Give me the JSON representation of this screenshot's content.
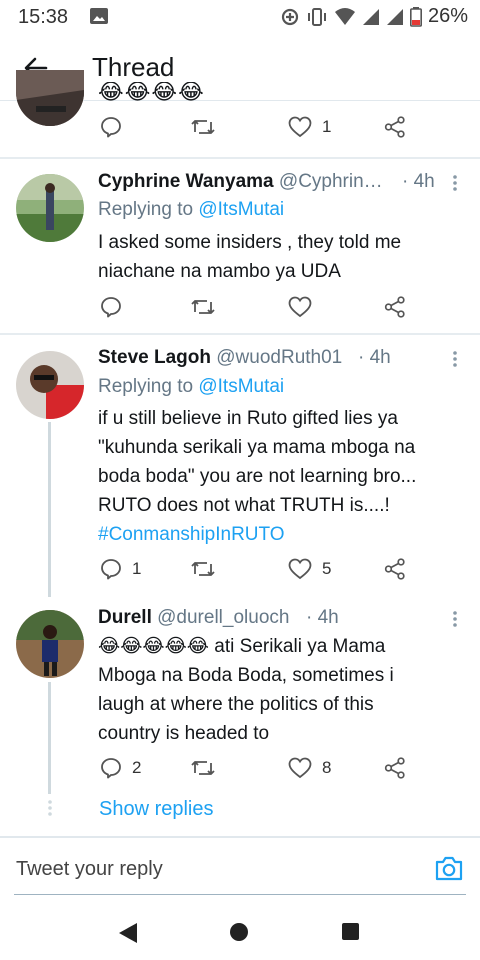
{
  "status_bar": {
    "time": "15:38",
    "battery_percent": "26%"
  },
  "header": {
    "title": "Thread"
  },
  "previous_tweet": {
    "emojis": "😂😂😂😂",
    "like_count": "1"
  },
  "tweets": [
    {
      "name": "Cyphrine Wanyama",
      "handle": "@Cyphrin…",
      "time": "· 4h",
      "replying_prefix": "Replying to ",
      "replying_to": "@ItsMutai",
      "text_lines": [
        "I asked some insiders , they told me",
        "niachane na mambo ya UDA"
      ],
      "reply_count": "",
      "like_count": ""
    },
    {
      "name": "Steve Lagoh",
      "handle": "@wuodRuth01",
      "time": "· 4h",
      "replying_prefix": "Replying to ",
      "replying_to": "@ItsMutai",
      "text_lines": [
        "if u still believe in Ruto gifted lies ya",
        "\"kuhunda serikali ya mama mboga na",
        "boda boda\" you are not learning bro...",
        "RUTO does not what TRUTH is....!"
      ],
      "hashtag": "#ConmanshipInRUTO",
      "reply_count": "1",
      "like_count": "5"
    },
    {
      "name": "Durell",
      "handle": "@durell_oluoch",
      "time": "· 4h",
      "emojis": "😂😂😂😂😂",
      "text_lines": [
        " ati Serikali ya Mama",
        "Mboga na Boda Boda, sometimes i",
        "laugh at where the politics of this",
        "country is headed to"
      ],
      "reply_count": "2",
      "like_count": "8"
    }
  ],
  "show_replies_label": "Show replies",
  "composer": {
    "placeholder": "Tweet your reply"
  },
  "colors": {
    "accent": "#1da1f2",
    "secondary_text": "#657786",
    "divider": "#e6ecf0"
  }
}
